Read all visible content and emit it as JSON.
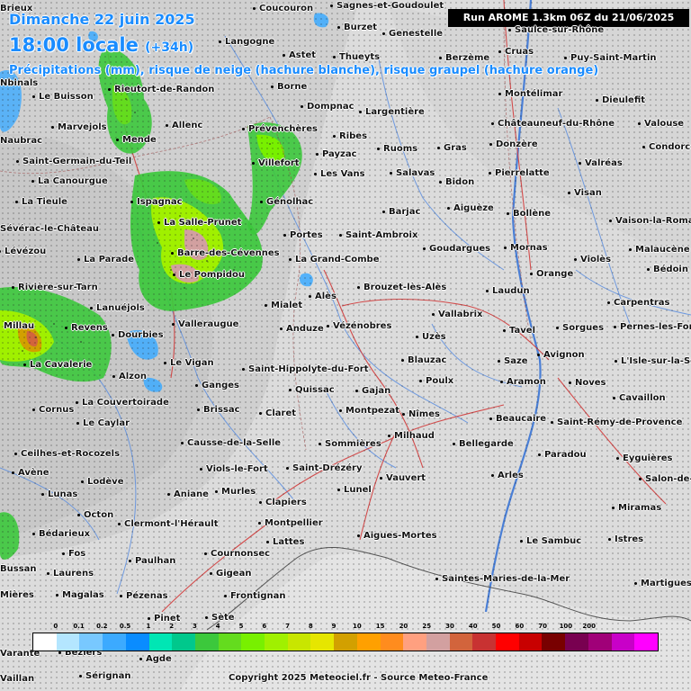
{
  "header": {
    "date": "Dimanche 22 juin 2025",
    "time_main": "18:00 locale",
    "time_offset": "(+34h)",
    "subtitle": "Précipitations (mm), risque de neige (hachure blanche), risque graupel (hachure orange)",
    "run": "Run AROME 1.3km 06Z du 21/06/2025"
  },
  "towns": [
    {
      "name": "Coucouron"
    },
    {
      "name": "Sagnes-et-Goudoulet"
    },
    {
      "name": "Burzet"
    },
    {
      "name": "Genestelle"
    },
    {
      "name": "Saulce-sur-Rhône"
    },
    {
      "name": "Langogne"
    },
    {
      "name": "Astet"
    },
    {
      "name": "Thueyts"
    },
    {
      "name": "Cruas"
    },
    {
      "name": "Berzème"
    },
    {
      "name": "Puy-Saint-Martin"
    },
    {
      "name": "Borne"
    },
    {
      "name": "Montélimar"
    },
    {
      "name": "Le Buisson"
    },
    {
      "name": "Rieutort-de-Randon"
    },
    {
      "name": "Dompnac"
    },
    {
      "name": "Largentière"
    },
    {
      "name": "Dieulefit"
    },
    {
      "name": "Marvejols"
    },
    {
      "name": "Allenc"
    },
    {
      "name": "Prévenchères"
    },
    {
      "name": "Châteauneuf-du-Rhône"
    },
    {
      "name": "Valouse"
    },
    {
      "name": "Ribes"
    },
    {
      "name": "Mende"
    },
    {
      "name": "Ruoms"
    },
    {
      "name": "Gras"
    },
    {
      "name": "Donzère"
    },
    {
      "name": "Condorcet"
    },
    {
      "name": "Payzac"
    },
    {
      "name": "Saint-Germain-du-Teil"
    },
    {
      "name": "Villefort"
    },
    {
      "name": "Valréas"
    },
    {
      "name": "Pierrelatte"
    },
    {
      "name": "Les Vans"
    },
    {
      "name": "Salavas"
    },
    {
      "name": "La Canourgue"
    },
    {
      "name": "Bidon"
    },
    {
      "name": "Visan"
    },
    {
      "name": "Ispagnac"
    },
    {
      "name": "La Tieule"
    },
    {
      "name": "Génolhac"
    },
    {
      "name": "Aiguèze"
    },
    {
      "name": "Barjac"
    },
    {
      "name": "Bollène"
    },
    {
      "name": "La Salle-Prunet"
    },
    {
      "name": "Vaison-la-Romaine"
    },
    {
      "name": "Sévérac-le-Château"
    },
    {
      "name": "Portes"
    },
    {
      "name": "Saint-Ambroix"
    },
    {
      "name": "Malaucène"
    },
    {
      "name": "Goudargues"
    },
    {
      "name": "Mornas"
    },
    {
      "name": "Barre-des-Cévennes"
    },
    {
      "name": "Lévézou"
    },
    {
      "name": "La Parade"
    },
    {
      "name": "La Grand-Combe"
    },
    {
      "name": "Violès"
    },
    {
      "name": "Bédoin"
    },
    {
      "name": "Le Pompidou"
    },
    {
      "name": "Orange"
    },
    {
      "name": "Rivière-sur-Tarn"
    },
    {
      "name": "Brouzet-lès-Alès"
    },
    {
      "name": "Laudun"
    },
    {
      "name": "Alès"
    },
    {
      "name": "Carpentras"
    },
    {
      "name": "Lanuéjols"
    },
    {
      "name": "Mialet"
    },
    {
      "name": "Vallabrix"
    },
    {
      "name": "Millau"
    },
    {
      "name": "Valleraugue"
    },
    {
      "name": "Revens"
    },
    {
      "name": "Anduze"
    },
    {
      "name": "Vézénobres"
    },
    {
      "name": "Sorgues"
    },
    {
      "name": "Pernes-les-Fontaines"
    },
    {
      "name": "Tavel"
    },
    {
      "name": "Uzès"
    },
    {
      "name": "Dourbies"
    },
    {
      "name": "Avignon"
    },
    {
      "name": "Blauzac"
    },
    {
      "name": "Saze"
    },
    {
      "name": "La Cavalerie"
    },
    {
      "name": "Le Vigan"
    },
    {
      "name": "L'Isle-sur-la-Sorgue"
    },
    {
      "name": "Saint-Hippolyte-du-Fort"
    },
    {
      "name": "Alzon"
    },
    {
      "name": "Poulx"
    },
    {
      "name": "Aramon"
    },
    {
      "name": "Noves"
    },
    {
      "name": "Ganges"
    },
    {
      "name": "Quissac"
    },
    {
      "name": "Gajan"
    },
    {
      "name": "La Couvertoirade"
    },
    {
      "name": "Cavaillon"
    },
    {
      "name": "Brissac"
    },
    {
      "name": "Claret"
    },
    {
      "name": "Montpezat"
    },
    {
      "name": "Nîmes"
    },
    {
      "name": "Cornus"
    },
    {
      "name": "Beaucaire"
    },
    {
      "name": "Le Caylar"
    },
    {
      "name": "Saint-Rémy-de-Provence"
    },
    {
      "name": "Milhaud"
    },
    {
      "name": "Causse-de-la-Selle"
    },
    {
      "name": "Sommières"
    },
    {
      "name": "Bellegarde"
    },
    {
      "name": "Paradou"
    },
    {
      "name": "Ceilhes-et-Rocozels"
    },
    {
      "name": "Eyguières"
    },
    {
      "name": "Viols-le-Fort"
    },
    {
      "name": "Saint-Drézéry"
    },
    {
      "name": "Avène"
    },
    {
      "name": "Arles"
    },
    {
      "name": "Vauvert"
    },
    {
      "name": "Lodève"
    },
    {
      "name": "Salon-de-Provence"
    },
    {
      "name": "Lunel"
    },
    {
      "name": "Murles"
    },
    {
      "name": "Lunas"
    },
    {
      "name": "Aniane"
    },
    {
      "name": "Clapiers"
    },
    {
      "name": "Miramas"
    },
    {
      "name": "Octon"
    },
    {
      "name": "Clermont-l'Hérault"
    },
    {
      "name": "Montpellier"
    },
    {
      "name": "Bédarieux"
    },
    {
      "name": "Aigues-Mortes"
    },
    {
      "name": "Lattes"
    },
    {
      "name": "Le Sambuc"
    },
    {
      "name": "Istres"
    },
    {
      "name": "Fos"
    },
    {
      "name": "Cournonsec"
    },
    {
      "name": "Paulhan"
    },
    {
      "name": "Laurens"
    },
    {
      "name": "Gigean"
    },
    {
      "name": "Saintes-Maries-de-la-Mer"
    },
    {
      "name": "Martigues"
    },
    {
      "name": "Magalas"
    },
    {
      "name": "Pézenas"
    },
    {
      "name": "Frontignan"
    },
    {
      "name": "Pinet"
    },
    {
      "name": "Sète"
    },
    {
      "name": "Agde"
    },
    {
      "name": "Sérignan"
    },
    {
      "name": "Béziers"
    },
    {
      "name": "Alès-partial-left-1",
      "display": "Brieux"
    },
    {
      "name": "p2",
      "display": "Nbinals"
    },
    {
      "name": "p3",
      "display": "Naubrac"
    },
    {
      "name": "p4",
      "display": "Vaillan"
    },
    {
      "name": "p5",
      "display": "Varante"
    },
    {
      "name": "p6",
      "display": "Bussan"
    },
    {
      "name": "p7",
      "display": "Mières"
    }
  ],
  "legend": {
    "labels": [
      "0",
      "0.1",
      "0.2",
      "0.5",
      "1",
      "2",
      "3",
      "4",
      "5",
      "6",
      "7",
      "8",
      "9",
      "10",
      "15",
      "20",
      "25",
      "30",
      "40",
      "50",
      "60",
      "70",
      "100",
      "200"
    ],
    "colors": [
      "#ffffff",
      "#b4e6ff",
      "#78c8ff",
      "#3caaff",
      "#0a8cff",
      "#00e6b4",
      "#00c88c",
      "#3cc83c",
      "#64dc1e",
      "#78f000",
      "#a0f000",
      "#c8e600",
      "#e6e600",
      "#d2a000",
      "#ffa000",
      "#ff8c1e",
      "#ffa080",
      "#d2a0a0",
      "#d2643c",
      "#c83232",
      "#ff0000",
      "#c80000",
      "#780000",
      "#780050",
      "#a00078",
      "#c800c8",
      "#ff00ff"
    ]
  },
  "copyright": "Copyright 2025 Meteociel.fr - Source Meteo-France"
}
